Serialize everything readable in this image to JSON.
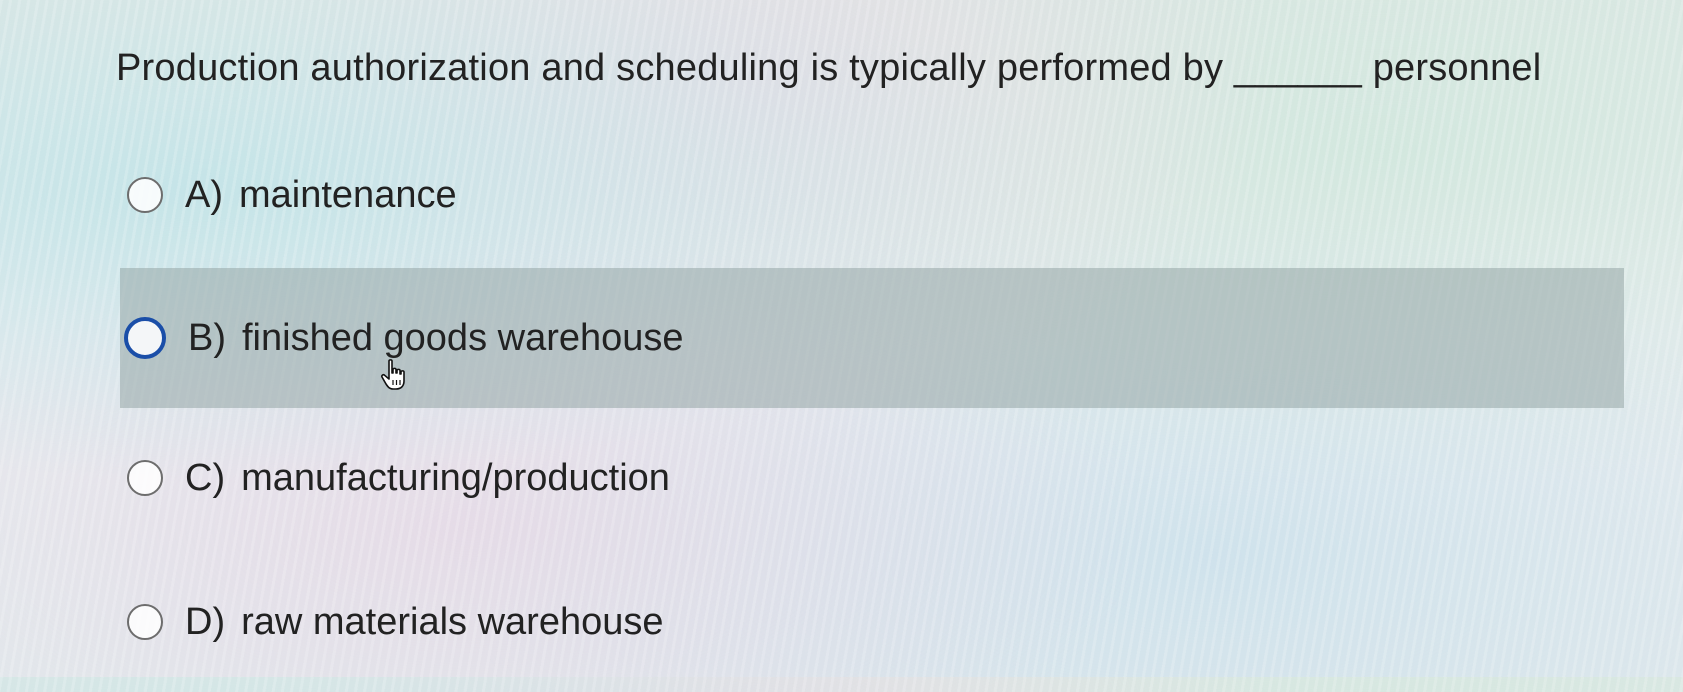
{
  "question": {
    "text": "Production authorization and scheduling is typically performed by ______ personnel"
  },
  "options": [
    {
      "letter": "A)",
      "text": "maintenance"
    },
    {
      "letter": "B)",
      "text": "finished goods warehouse"
    },
    {
      "letter": "C)",
      "text": "manufacturing/production"
    },
    {
      "letter": "D)",
      "text": "raw materials warehouse"
    }
  ],
  "colors": {
    "hover_highlight": "#96a5a5",
    "radio_hover_border": "#1a4ea8",
    "radio_border": "#6d6d6d",
    "text": "#222222"
  },
  "icons": {
    "cursor": "hand-pointer-icon"
  }
}
